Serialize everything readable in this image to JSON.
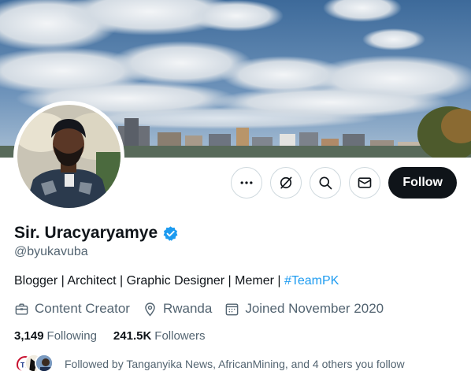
{
  "profile": {
    "name": "Sir. Uracyaryamye",
    "handle": "@byukavuba",
    "bio_text": "Blogger | Architect | Graphic Designer | Memer | ",
    "bio_hashtag": "#TeamPK",
    "category": "Content Creator",
    "location": "Rwanda",
    "joined": "Joined November 2020",
    "following_count": "3,149",
    "following_label": "Following",
    "followers_count": "241.5K",
    "followers_label": "Followers",
    "followed_by": "Followed by Tanganyika News, AfricanMining, and 4 others you follow"
  },
  "actions": {
    "follow_label": "Follow",
    "more_icon": "more-icon",
    "grok_icon": "grok-icon",
    "search_icon": "search-icon",
    "message_icon": "mail-icon"
  },
  "colors": {
    "accent": "#1d9bf0",
    "text_primary": "#0f1419",
    "text_secondary": "#536471",
    "follow_bg": "#0f1419"
  }
}
